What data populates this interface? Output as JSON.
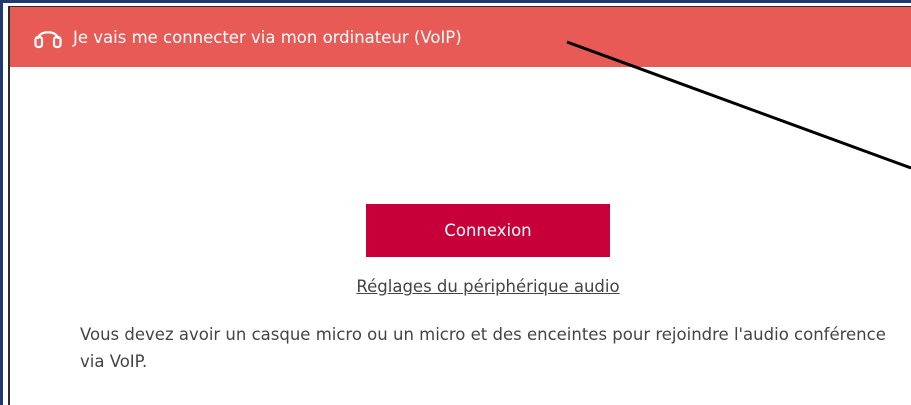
{
  "header": {
    "icon": "headset-icon",
    "title": "Je vais me connecter via mon ordinateur (VoIP)",
    "background": "#e85a56"
  },
  "main": {
    "connect_button_label": "Connexion",
    "connect_button_color": "#c8003a",
    "audio_settings_link": "Réglages du périphérique audio",
    "info_text": "Vous devez avoir un casque micro ou un micro et des enceintes pour rejoindre l'audio conférence via VoIP."
  }
}
